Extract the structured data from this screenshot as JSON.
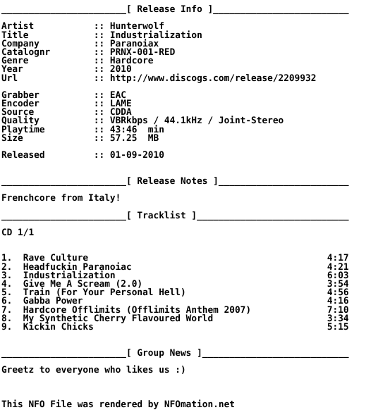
{
  "document": {
    "kind": "nfo-text-file",
    "columns": 64,
    "text_color": "#000000",
    "background_color": "#ffffff"
  },
  "sections": {
    "release_info": {
      "header_label": "[ Release Info ]",
      "header_title": "Release Info",
      "separator_char": "_",
      "separator_left_len": 23,
      "separator_right_len": 25,
      "fields": [
        {
          "label": "Artist",
          "sep": "::",
          "value": "Hunterwolf"
        },
        {
          "label": "Title",
          "sep": "::",
          "value": "Industrialization"
        },
        {
          "label": "Company",
          "sep": "::",
          "value": "Paranoiax"
        },
        {
          "label": "Catalognr",
          "sep": "::",
          "value": "PRNX-001-RED"
        },
        {
          "label": "Genre",
          "sep": "::",
          "value": "Hardcore"
        },
        {
          "label": "Year",
          "sep": "::",
          "value": "2010"
        },
        {
          "label": "Url",
          "sep": "::",
          "value": "http://www.discogs.com/release/2209932"
        }
      ],
      "fields2": [
        {
          "label": "Grabber",
          "sep": "::",
          "value": "EAC"
        },
        {
          "label": "Encoder",
          "sep": "::",
          "value": "LAME"
        },
        {
          "label": "Source",
          "sep": "::",
          "value": "CDDA"
        },
        {
          "label": "Quality",
          "sep": "::",
          "value": "VBRkbps / 44.1kHz / Joint-Stereo"
        },
        {
          "label": "Playtime",
          "sep": "::",
          "value": "43:46  min"
        },
        {
          "label": "Size",
          "sep": "::",
          "value": "57.25  MB"
        }
      ],
      "fields3": [
        {
          "label": "Released",
          "sep": "::",
          "value": "01-09-2010"
        }
      ]
    },
    "release_notes": {
      "header_label": "[ Release Notes ]",
      "header_title": "Release Notes",
      "body": "Frenchcore from Italy!"
    },
    "tracklist": {
      "header_label": "[ Tracklist ]",
      "header_title": "Tracklist",
      "disc_label": "CD 1/1",
      "tracks": [
        {
          "num": "1.",
          "title": "Rave Culture",
          "time": "4:17"
        },
        {
          "num": "2.",
          "title": "Headfuckin Paranoiac",
          "time": "4:21"
        },
        {
          "num": "3.",
          "title": "Industrialization",
          "time": "6:03"
        },
        {
          "num": "4.",
          "title": "Give Me A Scream (2.0)",
          "time": "3:54"
        },
        {
          "num": "5.",
          "title": "Train (For Your Personal Hell)",
          "time": "4:56"
        },
        {
          "num": "6.",
          "title": "Gabba Power",
          "time": "4:16"
        },
        {
          "num": "7.",
          "title": "Hardcore Offlimits (Offlimits Anthem 2007)",
          "time": "7:10"
        },
        {
          "num": "8.",
          "title": "My Synthetic Cherry Flavoured World",
          "time": "3:34"
        },
        {
          "num": "9.",
          "title": "Kickin Chicks",
          "time": "5:15"
        }
      ]
    },
    "group_news": {
      "header_label": "[ Group News ]",
      "header_title": "Group News",
      "body": "Greetz to everyone who likes us :)"
    },
    "footer": {
      "text": "This NFO File was rendered by NFOmation.net"
    }
  }
}
